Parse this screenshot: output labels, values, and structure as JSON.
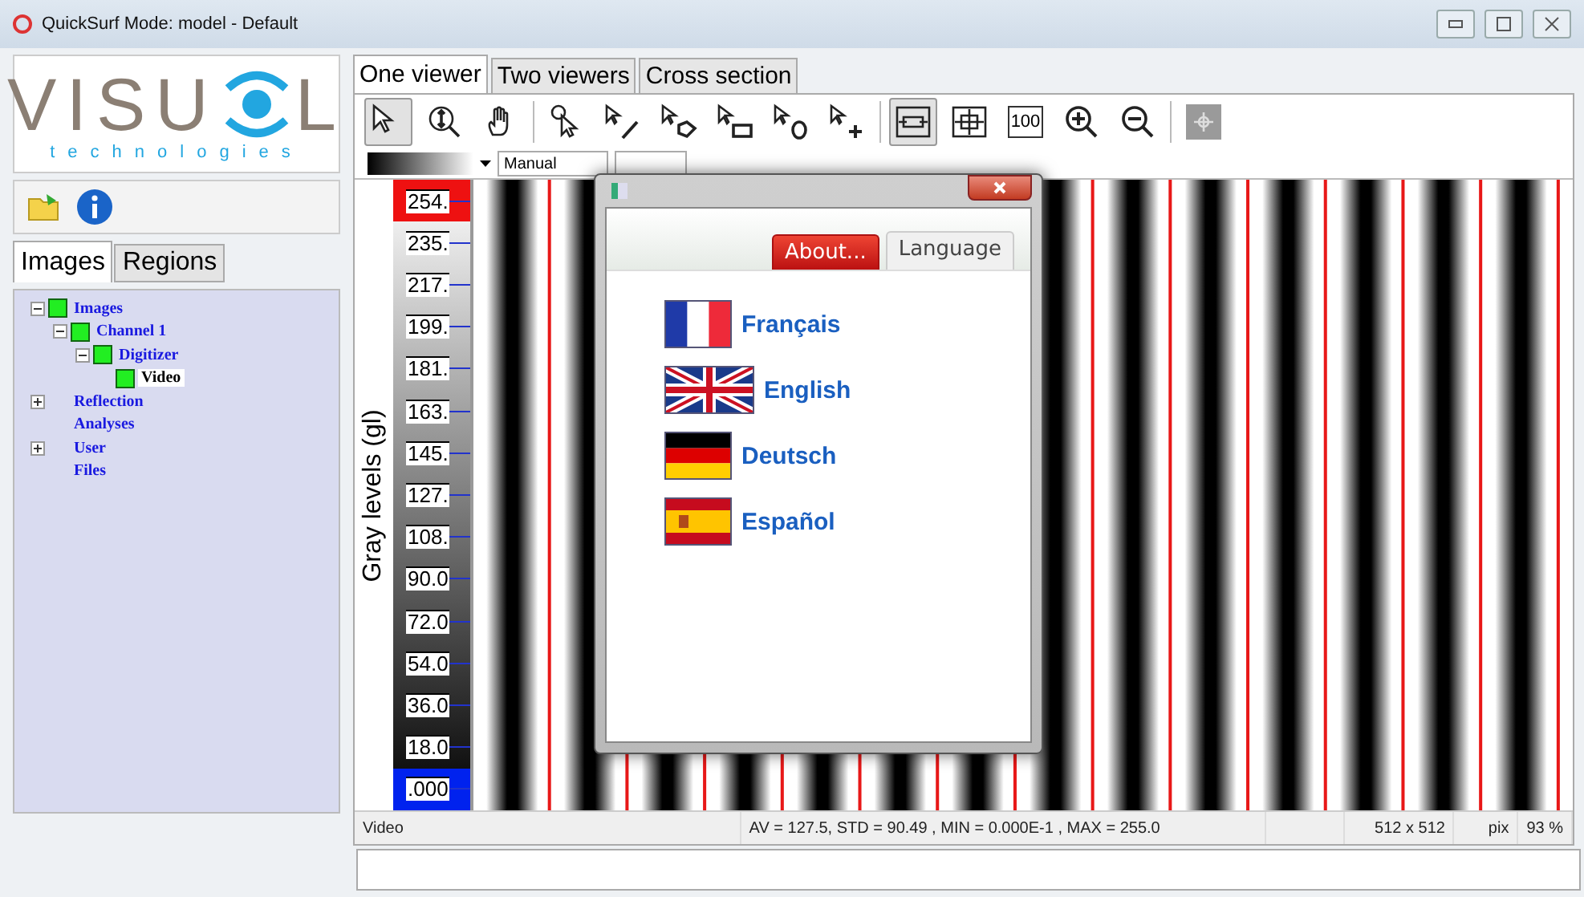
{
  "window": {
    "title": "QuickSurf Mode: model -  Default"
  },
  "logo": {
    "left": "VISU",
    "right": "L",
    "tagline": "technologies"
  },
  "side_tabs": [
    {
      "label": "Images",
      "selected": true
    },
    {
      "label": "Regions",
      "selected": false
    }
  ],
  "tree": [
    {
      "label": "Images",
      "marked": true,
      "expanded": true,
      "selected": false,
      "children": [
        {
          "label": "Channel 1",
          "marked": true,
          "expanded": true,
          "selected": false,
          "children": [
            {
              "label": "Digitizer",
              "marked": true,
              "expanded": true,
              "selected": false,
              "children": [
                {
                  "label": "Video",
                  "marked": true,
                  "selected": true
                }
              ]
            }
          ]
        }
      ]
    },
    {
      "label": "Reflection",
      "marked": false,
      "expanded": false,
      "selected": false
    },
    {
      "label": "Analyses",
      "marked": false,
      "selected": false
    },
    {
      "label": "User",
      "marked": false,
      "expanded": false,
      "selected": false
    },
    {
      "label": "Files",
      "marked": false,
      "selected": false
    }
  ],
  "viewer_tabs": [
    {
      "label": "One viewer",
      "selected": true
    },
    {
      "label": "Two viewers",
      "selected": false
    },
    {
      "label": "Cross section",
      "selected": false
    }
  ],
  "toolbar": [
    {
      "kind": "pointer",
      "pressed": true
    },
    {
      "kind": "zoom-extent",
      "pressed": false
    },
    {
      "kind": "hand",
      "pressed": false
    },
    {
      "kind": "sep"
    },
    {
      "kind": "pick",
      "pressed": false
    },
    {
      "kind": "line",
      "pressed": false
    },
    {
      "kind": "polygon",
      "pressed": false
    },
    {
      "kind": "rect",
      "pressed": false
    },
    {
      "kind": "ellipse",
      "pressed": false
    },
    {
      "kind": "cross",
      "pressed": false
    },
    {
      "kind": "sep"
    },
    {
      "kind": "fit-width",
      "pressed": true
    },
    {
      "kind": "fit-page",
      "pressed": false
    },
    {
      "kind": "text",
      "label": "100",
      "pressed": false
    },
    {
      "kind": "zoom-in",
      "pressed": false
    },
    {
      "kind": "zoom-out",
      "pressed": false
    },
    {
      "kind": "sep"
    },
    {
      "kind": "target",
      "pressed": false,
      "disabled": true
    }
  ],
  "range": {
    "mode": "Manual"
  },
  "scale": {
    "title": "Gray levels (gl)",
    "ticks": [
      "254.",
      "235.",
      "217.",
      "199.",
      "181.",
      "163.",
      "145.",
      "127.",
      "108.",
      "90.0",
      "72.0",
      "54.0",
      "36.0",
      "18.0",
      ".000"
    ]
  },
  "dialog": {
    "tabs": [
      {
        "label": "About...",
        "selected": false,
        "hovered": true
      },
      {
        "label": "Language",
        "selected": true,
        "hovered": false
      }
    ],
    "languages": [
      {
        "label": "Français",
        "kind": "fr"
      },
      {
        "label": "English",
        "kind": "gb"
      },
      {
        "label": "Deutsch",
        "kind": "de"
      },
      {
        "label": "Español",
        "kind": "es"
      }
    ]
  },
  "status_bar": {
    "name": "Video",
    "stats": "AV = 127.5, STD = 90.49 , MIN = 0.000E-1 , MAX = 255.0",
    "size": "512 x 512",
    "unit": "pix",
    "zoom": "93 %"
  }
}
